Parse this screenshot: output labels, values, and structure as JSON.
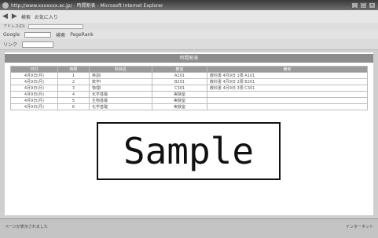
{
  "window": {
    "title": "http://www.xxxxxxx.ac.jp/ - 時間割表 - Microsoft Internet Explorer"
  },
  "navbar": {
    "back": "◀",
    "forward": "▶",
    "search_label": "検索",
    "favorites_label": "お気に入り"
  },
  "address": {
    "label": "アドレス(D)"
  },
  "toolbar2": {
    "google_label": "Google",
    "search_btn": "検索",
    "pagerank_label": "PageRank"
  },
  "toolbar3": {
    "links_label": "リンク"
  },
  "page": {
    "header": "時間割表",
    "columns": [
      "日付",
      "時限",
      "科目名",
      "教室",
      "備考"
    ],
    "rows": [
      {
        "date": "4月9日(月)",
        "period": "1",
        "subject": "英語Ⅰ",
        "room": "A101",
        "note": "教科書 4月9日 1限 A101"
      },
      {
        "date": "4月9日(月)",
        "period": "2",
        "subject": "数学Ⅰ",
        "room": "B201",
        "note": "教科書 4月9日 2限 B201"
      },
      {
        "date": "4月9日(月)",
        "period": "3",
        "subject": "物理Ⅰ",
        "room": "C301",
        "note": "教科書 4月9日 3限 C301"
      },
      {
        "date": "4月9日(月)",
        "period": "4",
        "subject": "化学基礎",
        "room": "実験室",
        "note": ""
      },
      {
        "date": "4月9日(月)",
        "period": "5",
        "subject": "生物基礎",
        "room": "実験室",
        "note": ""
      },
      {
        "date": "4月9日(月)",
        "period": "6",
        "subject": "化学基礎",
        "room": "実験室",
        "note": ""
      }
    ]
  },
  "overlay": {
    "text": "Sample"
  },
  "status": {
    "left": "ページが表示されました",
    "right": "インターネット"
  }
}
